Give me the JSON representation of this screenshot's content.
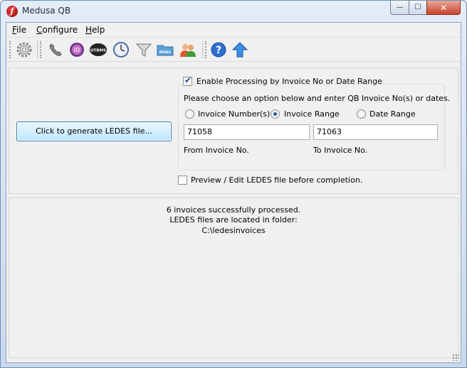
{
  "window": {
    "title": "Medusa QB",
    "app_icon_glyph": "ƒ",
    "min_glyph": "—",
    "max_glyph": "☐",
    "close_glyph": "✕"
  },
  "menu": {
    "items": [
      "File",
      "Configure",
      "Help"
    ]
  },
  "toolbar": {
    "icons": [
      "gear-icon",
      "telephone-icon",
      "id-disc-icon",
      "utbms-icon",
      "clock-icon",
      "filter-icon",
      "misc-folder-icon",
      "users-icon",
      "help-icon",
      "upload-arrow-icon"
    ],
    "utbms_text": "UTBMS",
    "misc_text": "misc",
    "id_text": "ID",
    "help_text": "?"
  },
  "main": {
    "generate_button": "Click to generate LEDES file...",
    "enable_processing": {
      "label": "Enable Processing by Invoice No or Date Range",
      "checked": true
    },
    "instruction": "Please choose an option below and enter QB Invoice No(s) or dates.",
    "options": [
      {
        "label": "Invoice Number(s)",
        "selected": false
      },
      {
        "label": "Invoice Range",
        "selected": true
      },
      {
        "label": "Date Range",
        "selected": false
      }
    ],
    "from_value": "71058",
    "to_value": "71063",
    "from_label": "From Invoice No.",
    "to_label": "To Invoice No.",
    "preview": {
      "label": "Preview / Edit LEDES file before completion.",
      "checked": false
    }
  },
  "status": {
    "line1": "6 invoices successfully processed.",
    "line2": "LEDES files are located in folder:",
    "line3": "C:\\ledesinvoices"
  },
  "colors": {
    "accent_blue": "#3c7fb1",
    "close_red": "#c8442d"
  }
}
